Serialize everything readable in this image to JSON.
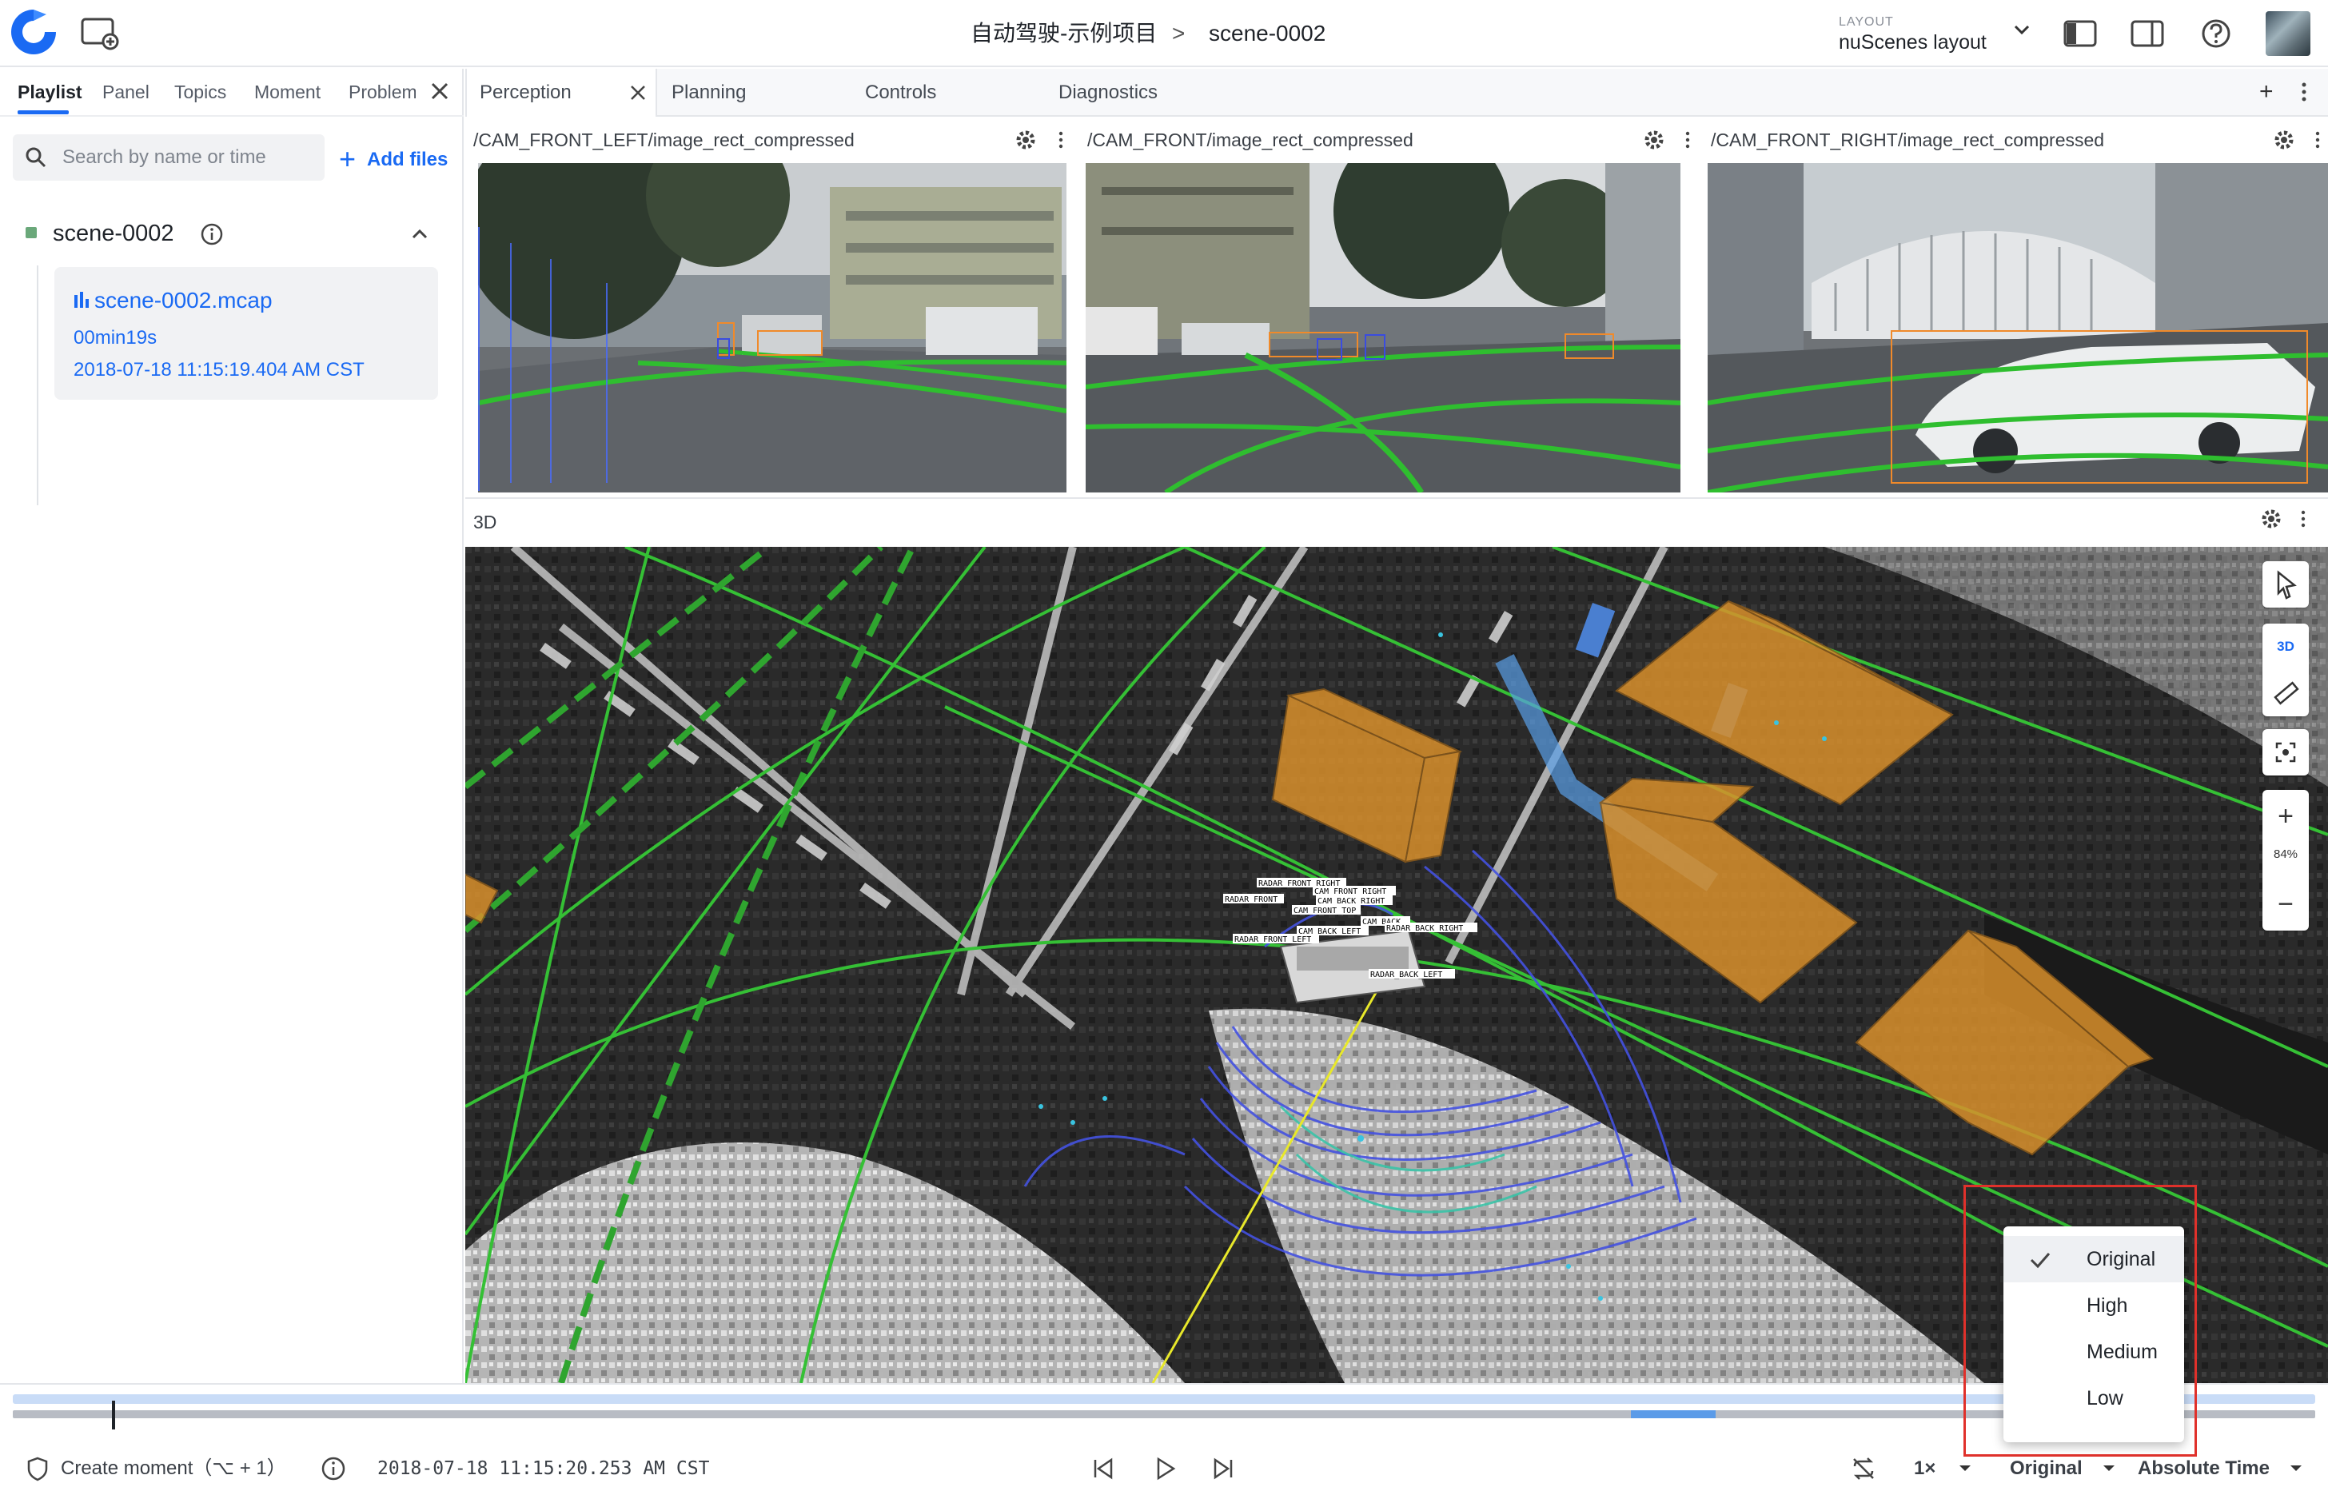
{
  "topbar": {
    "project": "自动驾驶-示例项目",
    "separator": ">",
    "scene": "scene-0002",
    "layout_caption": "LAYOUT",
    "layout_name": "nuScenes layout"
  },
  "sidebar": {
    "tabs": [
      "Playlist",
      "Panel",
      "Topics",
      "Moment",
      "Problem"
    ],
    "active_tab": "Playlist",
    "search_placeholder": "Search by name or time",
    "add_files": "Add files",
    "scene": {
      "name": "scene-0002",
      "file": {
        "name": "scene-0002.mcap",
        "duration": "00min19s",
        "time": "2018-07-18 11:15:19.404 AM CST"
      }
    }
  },
  "main": {
    "tabs": [
      "Perception",
      "Planning",
      "Controls",
      "Diagnostics"
    ],
    "active_tab": "Perception",
    "cameras": [
      "/CAM_FRONT_LEFT/image_rect_compressed",
      "/CAM_FRONT/image_rect_compressed",
      "/CAM_FRONT_RIGHT/image_rect_compressed"
    ],
    "panel3d_title": "3D",
    "view_mode": "3D",
    "zoom": "84%",
    "vehicle_labels": [
      "RADAR_FRONT_RIGHT",
      "CAM_FRONT_RIGHT",
      "RADAR_FRONT",
      "CAM_BACK_RIGHT",
      "CAM_FRONT_TOP",
      "CAM_BACK",
      "CAM_BACK_LEFT",
      "RADAR_BACK_RIGHT",
      "RADAR_FRONT_LEFT",
      "RADAR_BACK_LEFT"
    ]
  },
  "bottom": {
    "create_moment": "Create moment（⌥ + 1）",
    "timestamp": "2018-07-18 11:15:20.253 AM CST",
    "speed": "1×",
    "quality": "Original",
    "time_mode": "Absolute Time"
  },
  "quality_menu": {
    "options": [
      "Original",
      "High",
      "Medium",
      "Low"
    ],
    "selected": "Original"
  },
  "colors": {
    "accent": "#1a6af3",
    "highlight_border": "#e0312b",
    "box_fill": "#d9902c",
    "lane_green": "#3cc33c"
  }
}
